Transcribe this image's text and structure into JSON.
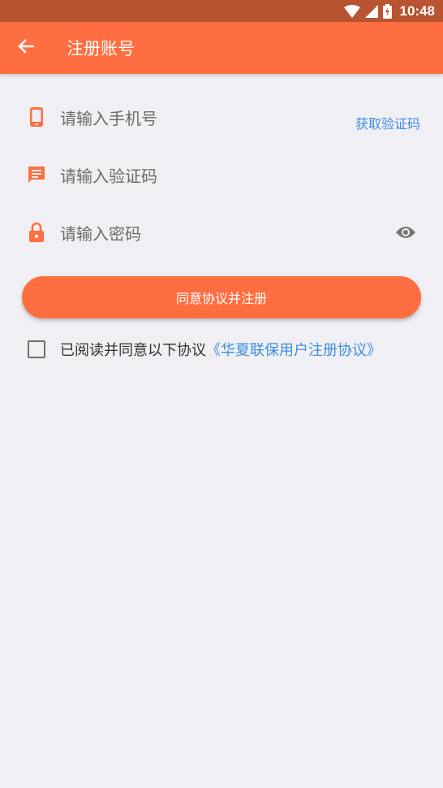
{
  "status_bar": {
    "time": "10:48"
  },
  "app_bar": {
    "title": "注册账号"
  },
  "form": {
    "phone_placeholder": "请输入手机号",
    "get_code_label": "获取验证码",
    "code_placeholder": "请输入验证码",
    "password_placeholder": "请输入密码"
  },
  "submit": {
    "label": "同意协议并注册"
  },
  "agreement": {
    "checked": false,
    "text": "已阅读并同意以下协议",
    "link_text": "《华夏联保用户注册协议》"
  },
  "colors": {
    "accent": "#ff6e40",
    "status_bar": "#b85431",
    "link": "#3d8fe0",
    "background": "#f0eff4"
  },
  "icons": [
    "wifi-icon",
    "signal-icon",
    "battery-icon",
    "back-arrow-icon",
    "phone-icon",
    "message-icon",
    "lock-icon",
    "eye-icon"
  ]
}
